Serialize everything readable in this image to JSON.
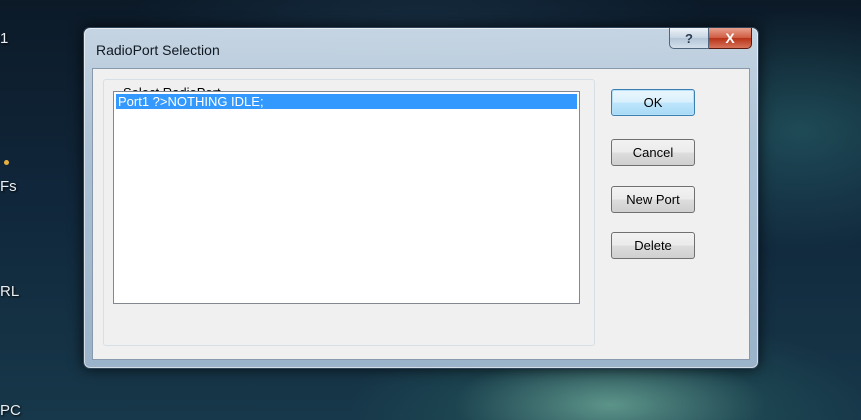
{
  "desktop": {
    "labels": [
      "1",
      "Fs",
      "RL",
      "PC"
    ]
  },
  "dialog": {
    "title": "RadioPort Selection",
    "help_glyph": "?",
    "close_glyph": "X",
    "group_label": "Select RadioPort",
    "ports": [
      {
        "text": "Port1 ?>NOTHING IDLE;",
        "selected": true
      }
    ],
    "buttons": {
      "ok": "OK",
      "cancel": "Cancel",
      "new_port": "New Port",
      "delete": "Delete"
    }
  },
  "colors": {
    "selection": "#3399ff",
    "default_button_border": "#3c7fb1"
  }
}
